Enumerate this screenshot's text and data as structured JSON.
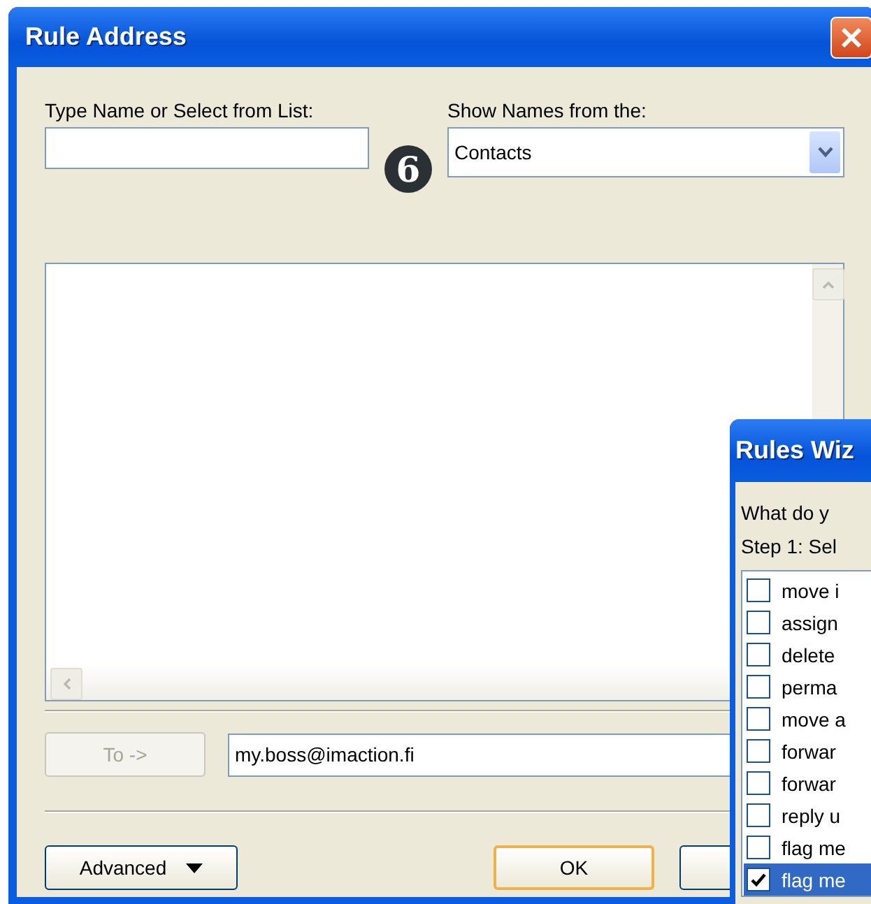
{
  "window": {
    "title": "Rule Address"
  },
  "name_field": {
    "label": "Type Name or Select from List:"
  },
  "callout": {
    "label": "6"
  },
  "address_book": {
    "label": "Show Names from the:",
    "value": "Contacts"
  },
  "to_button": {
    "label": "To ->",
    "disabled": true
  },
  "recipient_field": {
    "value": "my.boss@imaction.fi"
  },
  "buttons": [
    {
      "kind": "menu",
      "label": "Advanced"
    },
    {
      "kind": "default",
      "label": "OK"
    },
    {
      "kind": "plain"
    }
  ],
  "wizard": {
    "title": "Rules Wiz",
    "prompt": "What do y",
    "step": "Step 1: Sel",
    "actions": [
      {
        "label": "move i",
        "checked": false,
        "selected": false
      },
      {
        "label": "assign",
        "checked": false,
        "selected": false
      },
      {
        "label": "delete",
        "checked": false,
        "selected": false
      },
      {
        "label": "perma",
        "checked": false,
        "selected": false
      },
      {
        "label": "move a",
        "checked": false,
        "selected": false
      },
      {
        "label": "forwar",
        "checked": false,
        "selected": false
      },
      {
        "label": "forwar",
        "checked": false,
        "selected": false
      },
      {
        "label": "reply u",
        "checked": false,
        "selected": false
      },
      {
        "label": "flag me",
        "checked": false,
        "selected": false
      },
      {
        "label": "flag me",
        "checked": true,
        "selected": true
      }
    ]
  }
}
